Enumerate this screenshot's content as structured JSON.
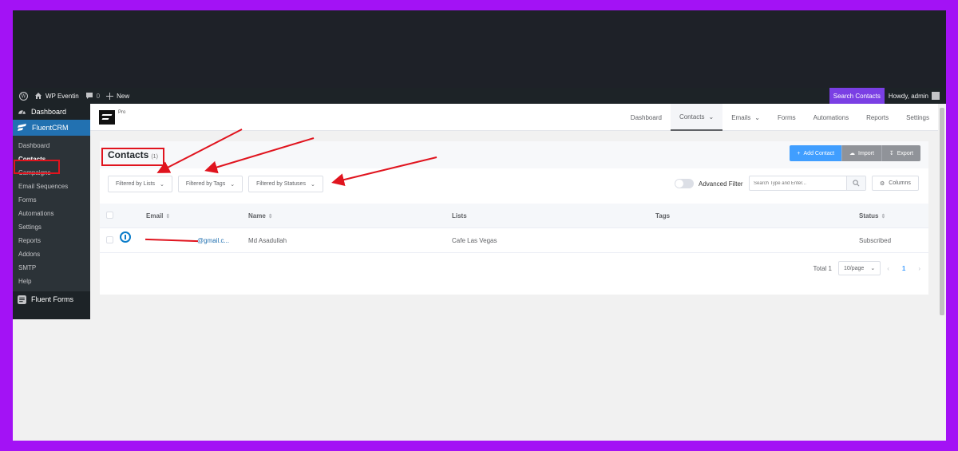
{
  "admin_bar": {
    "site_name": "WP Eventin",
    "comments_count": "0",
    "new_label": "New",
    "search_contacts": "Search Contacts",
    "howdy": "Howdy, admin"
  },
  "sidebar": {
    "dashboard": "Dashboard",
    "plugin": "FluentCRM",
    "items": [
      {
        "label": "Dashboard"
      },
      {
        "label": "Contacts"
      },
      {
        "label": "Campaigns"
      },
      {
        "label": "Email Sequences"
      },
      {
        "label": "Forms"
      },
      {
        "label": "Automations"
      },
      {
        "label": "Settings"
      },
      {
        "label": "Reports"
      },
      {
        "label": "Addons"
      },
      {
        "label": "SMTP"
      },
      {
        "label": "Help"
      }
    ],
    "fluent_forms": "Fluent Forms"
  },
  "topnav": {
    "pro": "Pro",
    "items": [
      {
        "label": "Dashboard"
      },
      {
        "label": "Contacts"
      },
      {
        "label": "Emails"
      },
      {
        "label": "Forms"
      },
      {
        "label": "Automations"
      },
      {
        "label": "Reports"
      },
      {
        "label": "Settings"
      }
    ]
  },
  "contacts": {
    "title": "Contacts",
    "count": "(1)",
    "add_contact": "Add Contact",
    "import": "Import",
    "export": "Export",
    "filters": {
      "lists": "Filtered by Lists",
      "tags": "Filtered by Tags",
      "statuses": "Filtered by Statuses"
    },
    "advanced_filter": "Advanced Filter",
    "search_placeholder": "Search Type and Enter...",
    "columns_label": "Columns",
    "table": {
      "headers": {
        "email": "Email",
        "name": "Name",
        "lists": "Lists",
        "tags": "Tags",
        "status": "Status"
      },
      "rows": [
        {
          "email": "@gmail.c...",
          "name": "Md Asadullah",
          "lists": "Cafe Las Vegas",
          "tags": "",
          "status": "Subscribed"
        }
      ]
    },
    "pager": {
      "total": "Total 1",
      "per_page": "10/page",
      "page": "1"
    }
  },
  "colors": {
    "accent": "#409eff",
    "wp_blue": "#2271b1",
    "purple_bg": "#a312f5",
    "annotation_red": "#e0141e"
  }
}
